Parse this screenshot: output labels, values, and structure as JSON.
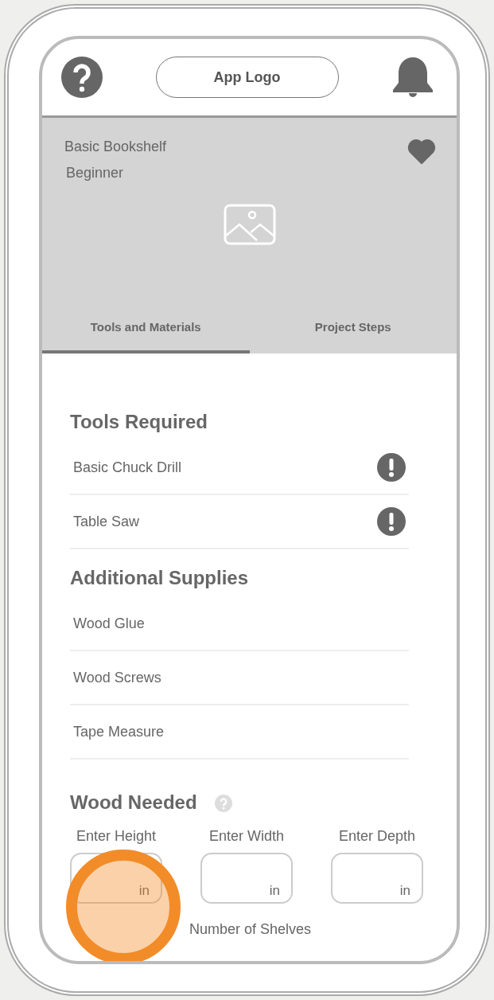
{
  "header": {
    "logo": "App Logo"
  },
  "project": {
    "title": "Basic Bookshelf",
    "level": "Beginner",
    "favorite": true
  },
  "tabs": [
    {
      "label": "Tools and Materials",
      "selected": true
    },
    {
      "label": "Project Steps",
      "selected": false
    }
  ],
  "sections": [
    {
      "title": "Tools Required",
      "items": [
        {
          "name": "Basic Chuck Drill",
          "warning": true
        },
        {
          "name": "Table Saw",
          "warning": true
        }
      ]
    },
    {
      "title": "Additional Supplies",
      "items": [
        {
          "name": "Wood Glue",
          "warning": false
        },
        {
          "name": "Wood Screws",
          "warning": false
        },
        {
          "name": "Tape Measure",
          "warning": false
        }
      ]
    }
  ],
  "wood": {
    "title": "Wood Needed",
    "help": true,
    "fields": [
      {
        "label": "Enter Height",
        "unit": "in"
      },
      {
        "label": "Enter Width",
        "unit": "in"
      },
      {
        "label": "Enter Depth",
        "unit": "in"
      }
    ],
    "shelves_label": "Number of Shelves"
  }
}
